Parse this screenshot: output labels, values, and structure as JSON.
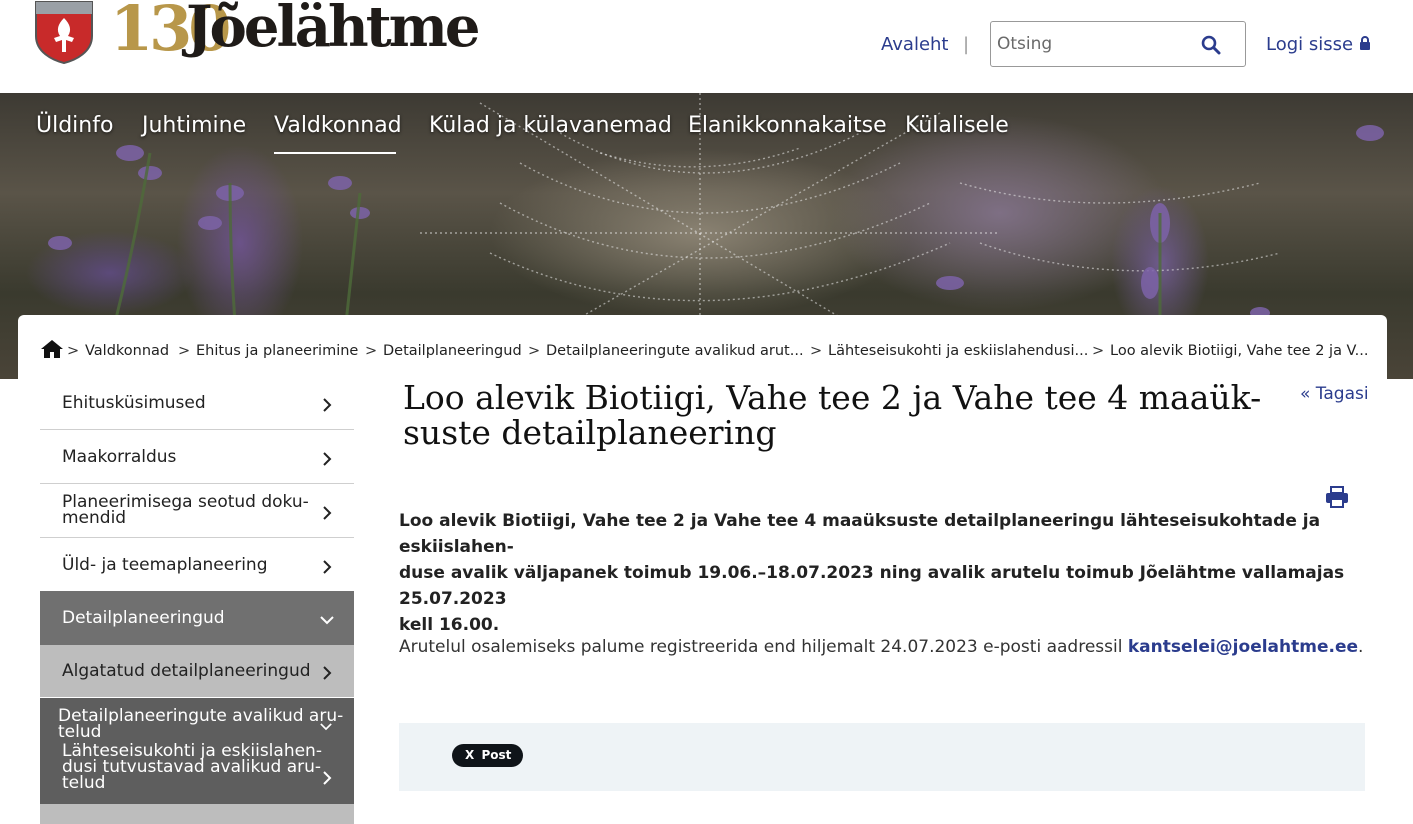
{
  "header": {
    "logo_number": "130",
    "logo_text": "Jõelähtme",
    "home_link": "Avaleht",
    "separator": "|",
    "search_placeholder": "Otsing",
    "login_link": "Logi sisse"
  },
  "nav": {
    "items": [
      "Üldinfo",
      "Juhtimine",
      "Valdkonnad",
      "Külad ja külavanemad",
      "Elanikkonnakaitse",
      "Külalisele"
    ],
    "active": "Valdkonnad"
  },
  "breadcrumb": {
    "separator": ">",
    "items": [
      "Valdkonnad",
      "Ehitus ja planeerimine",
      "Detailplaneeringud",
      "Detailplaneeringute avalikud arut...",
      "Lähteseisukohti ja eskiislahendusi...",
      "Loo alevik Biotiigi, Vahe tee 2 ja V..."
    ]
  },
  "sidebar": {
    "items": [
      "Ehitusküsimused",
      "Maakorraldus",
      "Planeerimisega seotud doku-\nmendid",
      "Üld- ja teemaplaneering",
      "Detailplaneeringud",
      "Algatatud detailplaneeringud",
      "Detailplaneeringute avalikud aru-\ntelud",
      "Lähteseisukohti ja eskiislahen-\ndusi tutvustavad avalikud aru-\ntelud"
    ]
  },
  "article": {
    "title": "Loo alevik Biotiigi, Vahe tee 2 ja Vahe tee 4 maaük-\nsuste detailplaneering",
    "back_link": "« Tagasi",
    "lead": "Loo alevik Biotiigi, Vahe tee 2 ja Vahe tee 4 maaüksuste detailplaneeringu lähteseisukohtade ja eskiislahen-\nduse avalik väljapanek toimub 19.06.–18.07.2023 ning avalik arutelu toimub Jõelähtme vallamajas 25.07.2023\nkell 16.00.",
    "body_text": "Arutelul osalemiseks palume registreerida end hiljemalt 24.07.2023 e-posti aadressil ",
    "email": "kantselei@joelahtme.ee",
    "body_end": ".",
    "share_button": "Post"
  },
  "colors": {
    "link": "#2b3c8d",
    "logo_gold": "#b8974a",
    "sidebar_active": "#707070",
    "share_bg": "#eef3f6"
  }
}
